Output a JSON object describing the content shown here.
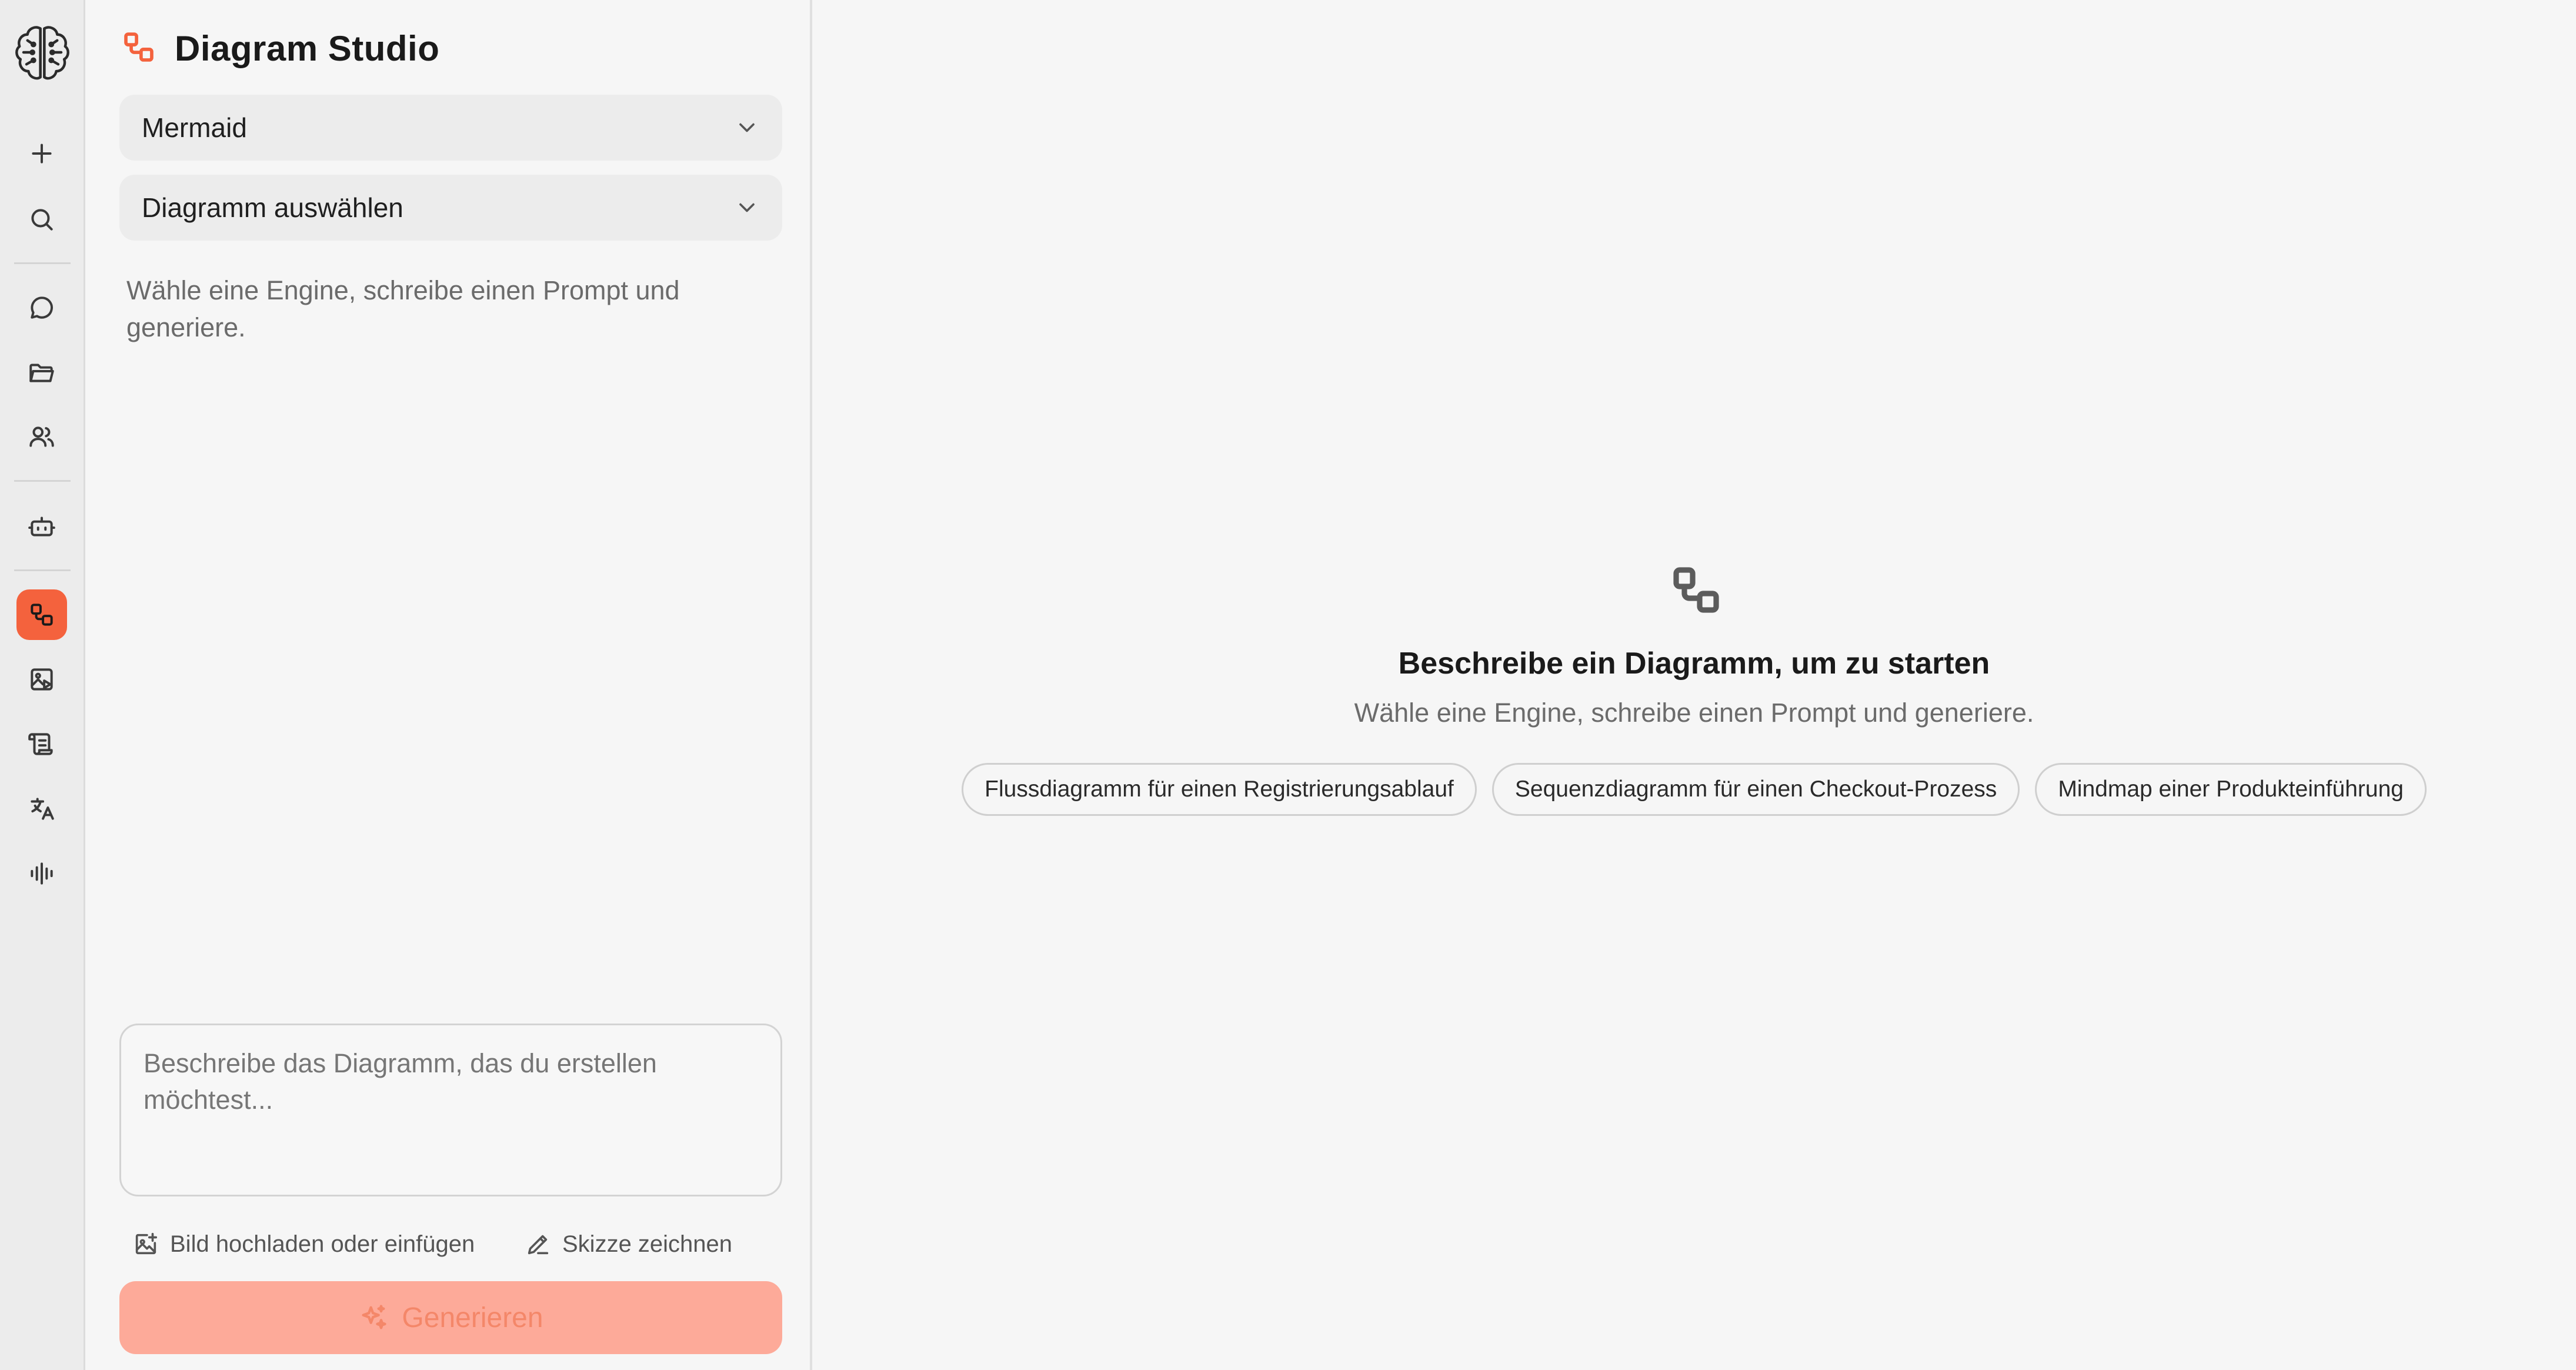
{
  "app": {
    "title": "Diagram Studio"
  },
  "rail": {
    "items": [
      {
        "icon": "plus-icon"
      },
      {
        "icon": "search-icon"
      },
      {
        "icon": "chat-icon"
      },
      {
        "icon": "folder-icon"
      },
      {
        "icon": "users-icon"
      },
      {
        "icon": "bot-icon"
      },
      {
        "icon": "diagram-icon",
        "active": true
      },
      {
        "icon": "image-play-icon"
      },
      {
        "icon": "scroll-icon"
      },
      {
        "icon": "translate-icon"
      },
      {
        "icon": "audio-wave-icon"
      }
    ]
  },
  "panel": {
    "engine_select": {
      "value": "Mermaid"
    },
    "diagram_select": {
      "value": "Diagramm auswählen"
    },
    "hint": "Wähle eine Engine, schreibe einen Prompt und generiere.",
    "prompt": {
      "placeholder": "Beschreibe das Diagramm, das du erstellen möchtest...",
      "value": ""
    },
    "tools": {
      "upload_label": "Bild hochladen oder einfügen",
      "sketch_label": "Skizze zeichnen"
    },
    "generate_label": "Generieren"
  },
  "main": {
    "empty_state": {
      "title": "Beschreibe ein Diagramm, um zu starten",
      "subtitle": "Wähle eine Engine, schreibe einen Prompt und generiere.",
      "suggestions": [
        "Flussdiagramm für einen Registrierungsablauf",
        "Sequenzdiagramm für einen Checkout-Prozess",
        "Mindmap einer Produkteinführung"
      ]
    }
  },
  "colors": {
    "accent": "#f4623d",
    "button_disabled_bg": "#fdaa99"
  }
}
